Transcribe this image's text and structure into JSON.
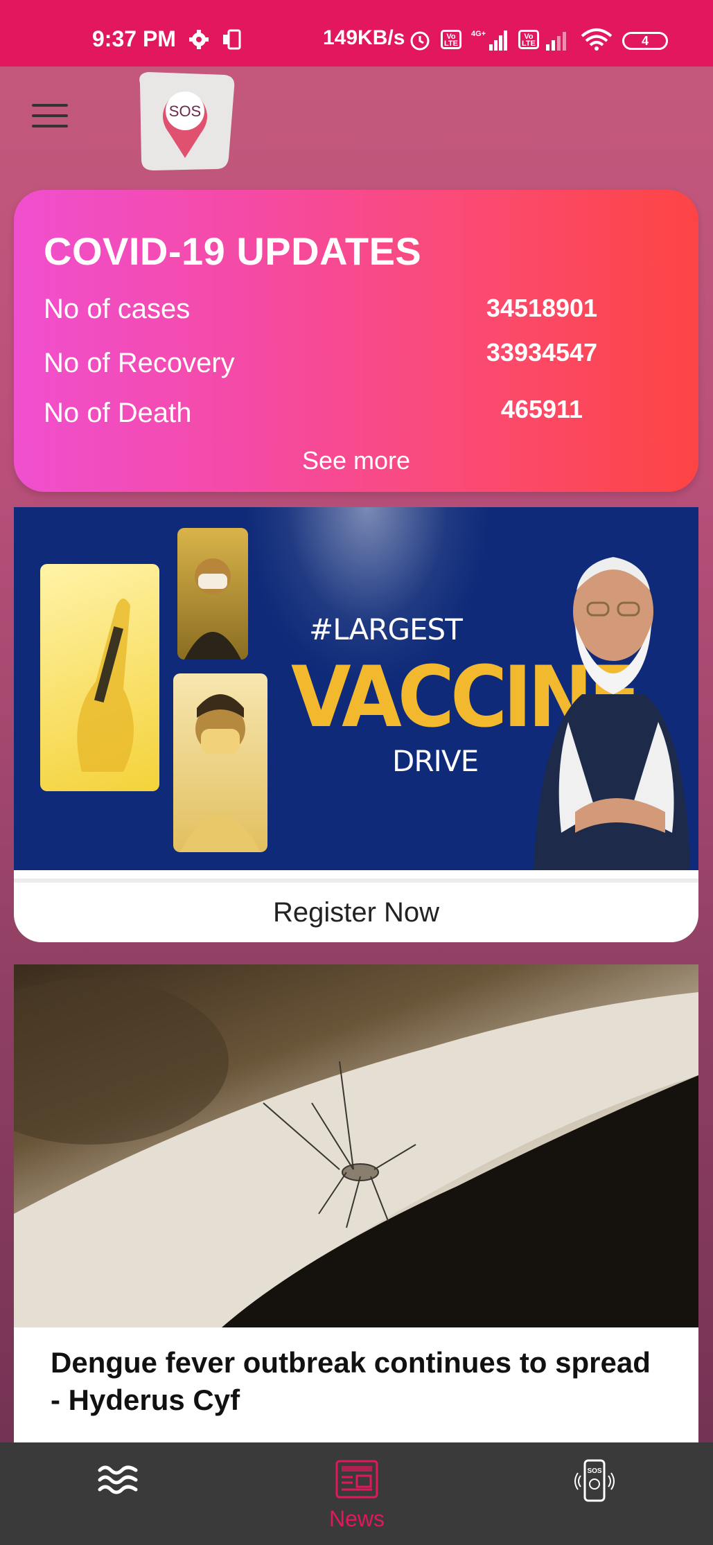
{
  "status_bar": {
    "time": "9:37 PM",
    "speed": "149KB/s",
    "volte1": "Vo LTE",
    "volte2": "Vo LTE",
    "network": "4G+",
    "battery": "4"
  },
  "header": {
    "logo_text": "SOS"
  },
  "covid": {
    "title": "COVID-19 UPDATES",
    "stats": [
      {
        "label": "No of cases",
        "value": "34518901"
      },
      {
        "label": "No of Recovery",
        "value": "33934547"
      },
      {
        "label": "No of Death",
        "value": "465911"
      }
    ],
    "see_more": "See more"
  },
  "vaccine": {
    "hashtag": "#LARGEST",
    "big": "VACCINE",
    "drive": "DRIVE",
    "register": "Register Now"
  },
  "news": {
    "headline": "Dengue fever outbreak continues to spread - Hyderus Cyf"
  },
  "bottom_nav": {
    "items": [
      {
        "icon": "waves-icon",
        "label": ""
      },
      {
        "icon": "newspaper-icon",
        "label": "News"
      },
      {
        "icon": "sos-phone-icon",
        "label": ""
      }
    ]
  },
  "colors": {
    "status_bar": "#e2175e",
    "accent": "#e2175e",
    "nav_bg": "#3a3a3a"
  }
}
